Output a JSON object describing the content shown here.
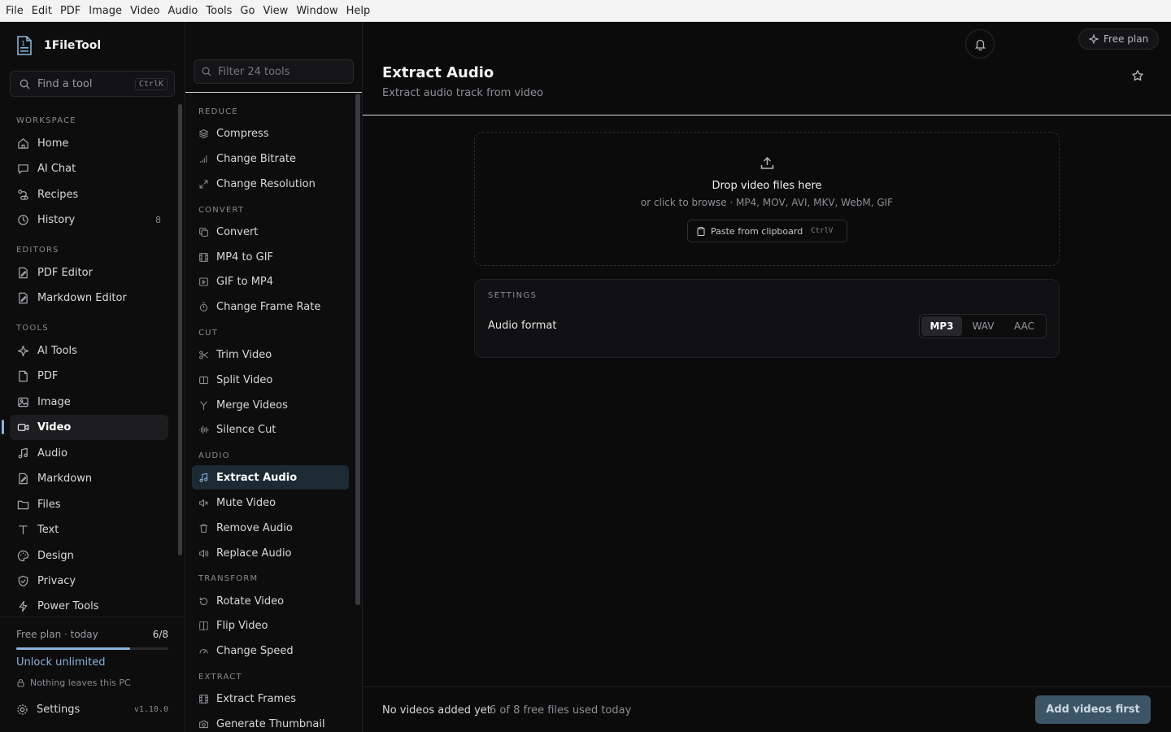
{
  "menubar": [
    "File",
    "Edit",
    "PDF",
    "Image",
    "Video",
    "Audio",
    "Tools",
    "Go",
    "View",
    "Window",
    "Help"
  ],
  "app": {
    "name": "1FileTool"
  },
  "search": {
    "placeholder": "Find a tool",
    "shortcut": "CtrlK"
  },
  "sidebar": {
    "sections": [
      "WORKSPACE",
      "EDITORS",
      "TOOLS"
    ],
    "workspace": [
      {
        "label": "Home",
        "icon": "home-icon"
      },
      {
        "label": "AI Chat",
        "icon": "chat-icon"
      },
      {
        "label": "Recipes",
        "icon": "recipes-icon"
      },
      {
        "label": "History",
        "icon": "history-icon",
        "count": "8"
      }
    ],
    "editors": [
      {
        "label": "PDF Editor",
        "icon": "pdf-editor-icon"
      },
      {
        "label": "Markdown Editor",
        "icon": "markdown-editor-icon"
      }
    ],
    "tools": [
      {
        "label": "AI Tools",
        "icon": "sparkle-icon"
      },
      {
        "label": "PDF",
        "icon": "file-icon"
      },
      {
        "label": "Image",
        "icon": "image-icon"
      },
      {
        "label": "Video",
        "icon": "video-icon",
        "active": true
      },
      {
        "label": "Audio",
        "icon": "music-icon"
      },
      {
        "label": "Markdown",
        "icon": "markdown-icon"
      },
      {
        "label": "Files",
        "icon": "folder-icon"
      },
      {
        "label": "Text",
        "icon": "text-icon"
      },
      {
        "label": "Design",
        "icon": "palette-icon"
      },
      {
        "label": "Privacy",
        "icon": "shield-icon"
      },
      {
        "label": "Power Tools",
        "icon": "bolt-icon"
      }
    ]
  },
  "plan": {
    "label": "Free plan · today",
    "used": "6/8",
    "fraction": 0.75,
    "unlock": "Unlock unlimited",
    "privacy": "Nothing leaves this PC",
    "settings": "Settings",
    "version": "v1.10.0"
  },
  "toolcol": {
    "filter_placeholder": "Filter 24 tools",
    "groups": [
      {
        "name": "REDUCE",
        "items": [
          "Compress",
          "Change Bitrate",
          "Change Resolution"
        ]
      },
      {
        "name": "CONVERT",
        "items": [
          "Convert",
          "MP4 to GIF",
          "GIF to MP4",
          "Change Frame Rate"
        ]
      },
      {
        "name": "CUT",
        "items": [
          "Trim Video",
          "Split Video",
          "Merge Videos",
          "Silence Cut"
        ]
      },
      {
        "name": "AUDIO",
        "items": [
          "Extract Audio",
          "Mute Video",
          "Remove Audio",
          "Replace Audio"
        ]
      },
      {
        "name": "TRANSFORM",
        "items": [
          "Rotate Video",
          "Flip Video",
          "Change Speed"
        ]
      },
      {
        "name": "EXTRACT",
        "items": [
          "Extract Frames",
          "Generate Thumbnail"
        ]
      }
    ],
    "active": "Extract Audio"
  },
  "header": {
    "free_plan": "Free plan",
    "title": "Extract Audio",
    "subtitle": "Extract audio track from video"
  },
  "dropzone": {
    "heading": "Drop video files here",
    "sub": "or click to browse · MP4, MOV, AVI, MKV, WebM, GIF",
    "paste_label": "Paste from clipboard",
    "paste_shortcut": "CtrlV"
  },
  "settings_card": {
    "label": "SETTINGS",
    "audio_format_label": "Audio format",
    "formats": [
      "MP3",
      "WAV",
      "AAC"
    ],
    "selected": "MP3"
  },
  "footer": {
    "status": "No videos added yet",
    "usage": "6 of 8 free files used today",
    "action": "Add videos first"
  },
  "colors": {
    "accent": "#8ab4d8",
    "button_bg": "#3b5466",
    "bg": "#0b0b0c"
  }
}
